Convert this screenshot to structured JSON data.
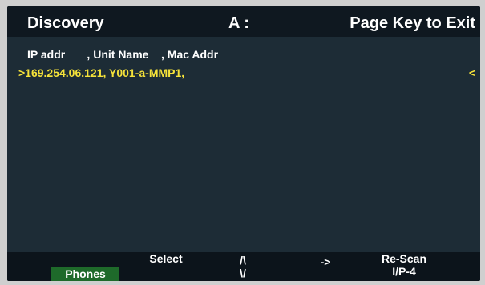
{
  "header": {
    "title": "Discovery",
    "drive": "A :",
    "exit_hint": "Page Key to Exit"
  },
  "table": {
    "columns_line": "IP addr       , Unit Name    , Mac Addr",
    "rows": [
      {
        "text": ">169.254.06.121, Y001-a-MMP1,",
        "end_marker": "<",
        "selected": true
      }
    ]
  },
  "softkeys": {
    "phones": "Phones",
    "select": "Select",
    "up": "/\\",
    "down": "\\/",
    "right": "->",
    "rescan": "Re-Scan",
    "page": "I/P-4"
  },
  "colors": {
    "screen_bg": "#1d2c36",
    "header_bg": "#0f1820",
    "selected_text": "#f5e23a",
    "phones_highlight": "#1e6a2a"
  }
}
